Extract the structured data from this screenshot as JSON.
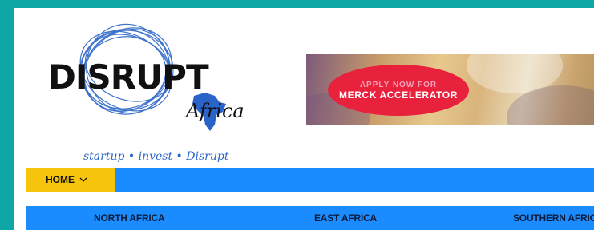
{
  "logo": {
    "wordmark": "DISRUPT",
    "sub": "Africa",
    "tagline": "startup • invest • Disrupt",
    "globe_icon": "scribble-globe-icon",
    "continent_icon": "africa-map-icon",
    "accent_color": "#2a64c8"
  },
  "banner": {
    "line1": "APPLY NOW FOR",
    "line2": "MERCK ACCELERATOR",
    "pill_color": "#e8213d"
  },
  "nav": {
    "home_label": "HOME",
    "home_icon": "chevron-down-icon",
    "bar_color": "#1a8cff",
    "home_color": "#f6c40a"
  },
  "regions": {
    "items": [
      "NORTH AFRICA",
      "EAST AFRICA",
      "SOUTHERN AFRICA"
    ]
  }
}
